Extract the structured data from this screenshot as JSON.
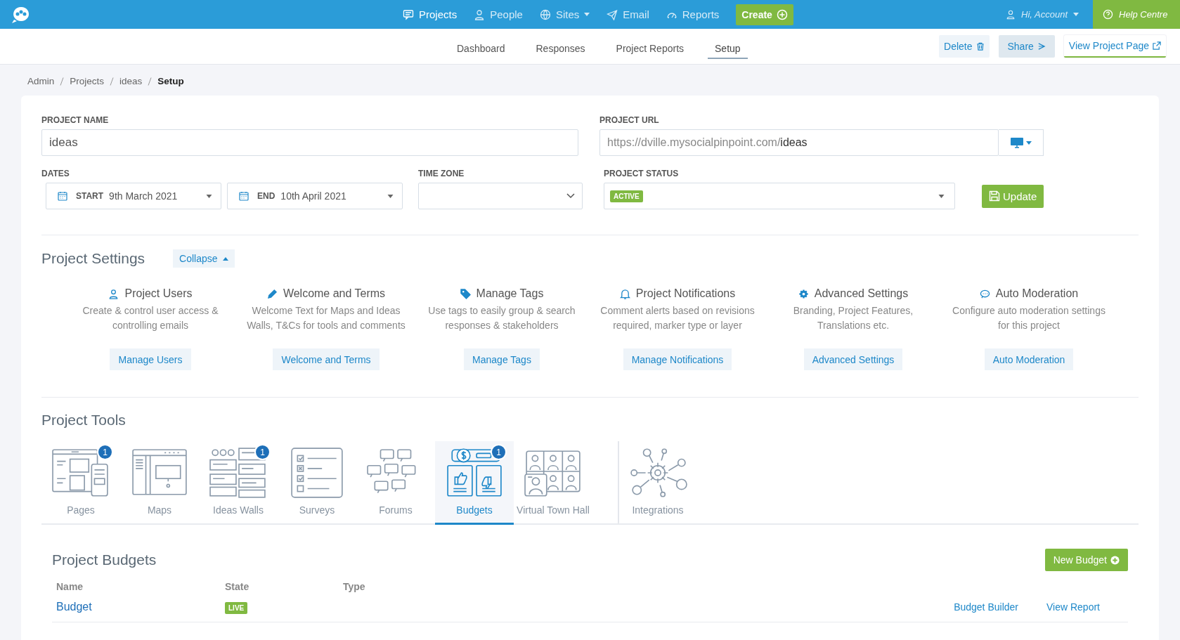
{
  "topbar": {
    "nav": [
      {
        "label": "Projects",
        "selected": true,
        "dropdown": false
      },
      {
        "label": "People",
        "selected": false,
        "dropdown": false
      },
      {
        "label": "Sites",
        "selected": false,
        "dropdown": true
      },
      {
        "label": "Email",
        "selected": false,
        "dropdown": false
      },
      {
        "label": "Reports",
        "selected": false,
        "dropdown": false
      }
    ],
    "create": "Create",
    "account": "Hi, Account",
    "help": "Help Centre"
  },
  "subnav": {
    "tabs": [
      {
        "label": "Dashboard",
        "selected": false
      },
      {
        "label": "Responses",
        "selected": false
      },
      {
        "label": "Project Reports",
        "selected": false
      },
      {
        "label": "Setup",
        "selected": true
      }
    ],
    "actions": [
      {
        "label": "Delete",
        "kind": "delete"
      },
      {
        "label": "Share",
        "kind": "share"
      },
      {
        "label": "View Project Page",
        "kind": "view"
      }
    ]
  },
  "breadcrumb": [
    {
      "label": "Admin",
      "current": false
    },
    {
      "label": "Projects",
      "current": false
    },
    {
      "label": "ideas",
      "current": false
    },
    {
      "label": "Setup",
      "current": true
    }
  ],
  "form": {
    "project_name": {
      "label": "PROJECT NAME",
      "value": "ideas"
    },
    "project_url": {
      "label": "PROJECT URL",
      "prefix": "https://dville.mysocialpinpoint.com/",
      "slug": "ideas"
    },
    "dates": {
      "label": "DATES",
      "start_label": "START",
      "start": "9th March 2021",
      "end_label": "END",
      "end": "10th April 2021"
    },
    "time_zone": {
      "label": "TIME ZONE"
    },
    "status": {
      "label": "PROJECT STATUS",
      "value": "ACTIVE"
    },
    "update": "Update"
  },
  "settings": {
    "title": "Project Settings",
    "collapse": "Collapse",
    "items": [
      {
        "title": "Project Users",
        "description": "Create & control user access & controlling emails",
        "button": "Manage Users"
      },
      {
        "title": "Welcome and Terms",
        "description": "Welcome Text for Maps and Ideas Walls, T&Cs for tools and comments",
        "button": "Welcome and Terms"
      },
      {
        "title": "Manage Tags",
        "description": "Use tags to easily group & search responses & stakeholders",
        "button": "Manage Tags"
      },
      {
        "title": "Project Notifications",
        "description": "Comment alerts based on revisions required, marker type or layer",
        "button": "Manage Notifications"
      },
      {
        "title": "Advanced Settings",
        "description": "Branding, Project Features, Translations etc.",
        "button": "Advanced Settings"
      },
      {
        "title": "Auto Moderation",
        "description": "Configure auto moderation settings for this project",
        "button": "Auto Moderation"
      }
    ]
  },
  "tools": {
    "title": "Project Tools",
    "items": [
      {
        "kind": "pages",
        "label": "Pages",
        "badge": "1",
        "selected": false
      },
      {
        "kind": "maps",
        "label": "Maps",
        "selected": false
      },
      {
        "kind": "ideas",
        "label": "Ideas Walls",
        "badge": "1",
        "selected": false
      },
      {
        "kind": "surveys",
        "label": "Surveys",
        "selected": false
      },
      {
        "kind": "forums",
        "label": "Forums",
        "selected": false
      },
      {
        "kind": "budgets",
        "label": "Budgets",
        "badge": "1",
        "selected": true
      },
      {
        "kind": "townhall",
        "label": "Virtual Town Hall",
        "selected": false
      },
      {
        "kind": "integrations",
        "label": "Integrations",
        "selected": false
      }
    ]
  },
  "budgets": {
    "title": "Project Budgets",
    "new_button": "New Budget",
    "columns": [
      "Name",
      "State",
      "Type"
    ],
    "rows": [
      {
        "name": "Budget",
        "state": "LIVE",
        "actions": [
          "Budget Builder",
          "View Report"
        ]
      }
    ]
  }
}
